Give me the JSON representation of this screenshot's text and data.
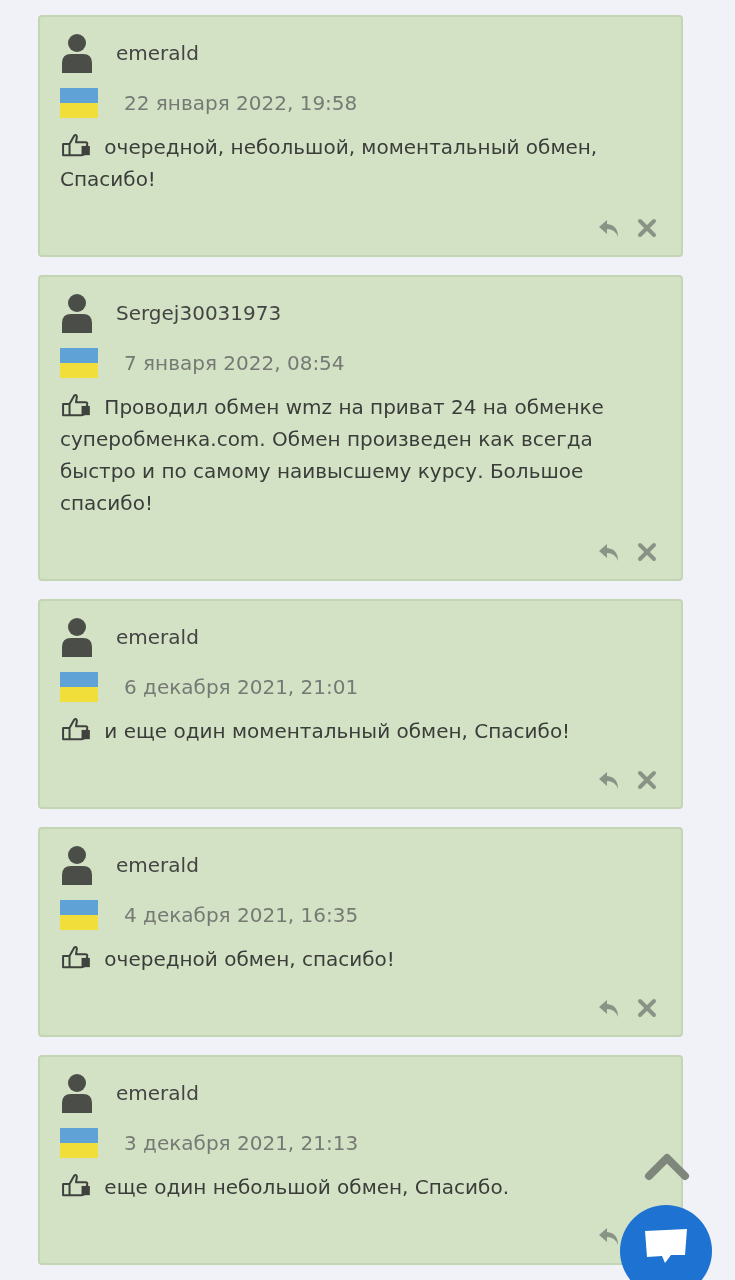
{
  "reviews": [
    {
      "author": "emerald",
      "date": "22 января 2022, 19:58",
      "kind": "positive",
      "text": "очередной, небольшой, моментальный обмен, Спасибо!"
    },
    {
      "author": "Sergej30031973",
      "date": "7 января 2022, 08:54",
      "kind": "positive",
      "text": "Проводил обмен wmz на приват 24 на обменке суперобменка.com. Обмен произведен как всегда быстро и по самому наивысшему курсу. Большое спасибо!"
    },
    {
      "author": "emerald",
      "date": "6 декабря 2021, 21:01",
      "kind": "positive",
      "text": "и еще один моментальный обмен, Спасибо!"
    },
    {
      "author": "emerald",
      "date": "4 декабря 2021, 16:35",
      "kind": "positive",
      "text": "очередной обмен, спасибо!"
    },
    {
      "author": "emerald",
      "date": "3 декабря 2021, 21:13",
      "kind": "positive",
      "text": "еще один небольшой обмен, Спасибо."
    }
  ]
}
